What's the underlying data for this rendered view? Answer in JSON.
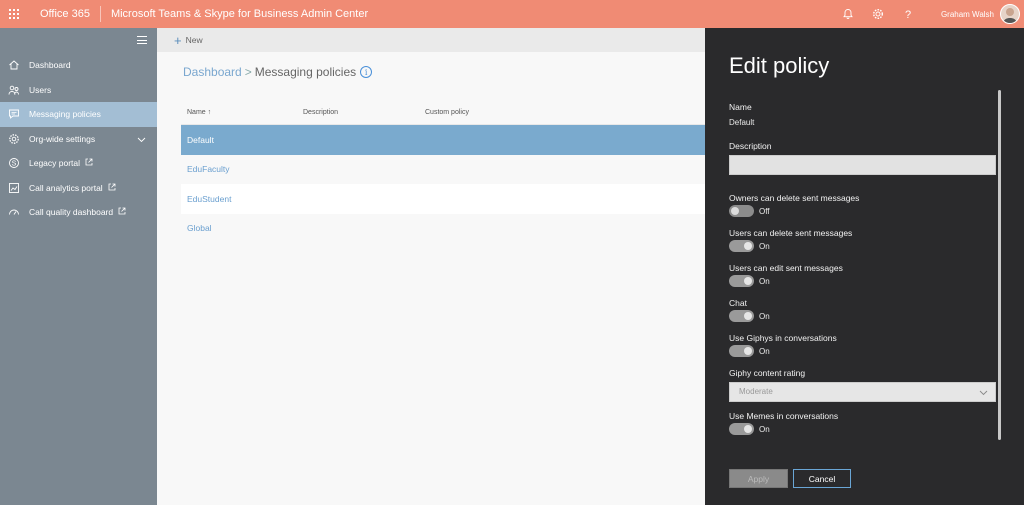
{
  "header": {
    "brand": "Office 365",
    "app_title": "Microsoft Teams & Skype for Business Admin Center",
    "user_name": "Graham Walsh",
    "icons": [
      "waffle-icon",
      "bell-icon",
      "gear-icon",
      "help-icon"
    ]
  },
  "sidebar": {
    "items": [
      {
        "label": "Dashboard",
        "icon": "home-icon"
      },
      {
        "label": "Users",
        "icon": "users-icon"
      },
      {
        "label": "Messaging policies",
        "icon": "chat-icon",
        "active": true
      },
      {
        "label": "Org-wide settings",
        "icon": "gear-icon"
      },
      {
        "label": "Legacy portal",
        "icon": "skype-icon",
        "external": true
      },
      {
        "label": "Call analytics portal",
        "icon": "chart-icon",
        "external": true
      },
      {
        "label": "Call quality dashboard",
        "icon": "dashboard-icon",
        "external": true
      }
    ]
  },
  "main": {
    "new_label": "New",
    "breadcrumb": {
      "root": "Dashboard",
      "sep": ">",
      "current": "Messaging policies",
      "info": "i"
    },
    "table": {
      "headers": {
        "name": "Name",
        "sort": "↑",
        "description": "Description",
        "custom": "Custom policy"
      },
      "rows": [
        "Default",
        "EduFaculty",
        "EduStudent",
        "Global"
      ]
    }
  },
  "panel": {
    "title": "Edit policy",
    "name_label": "Name",
    "name_value": "Default",
    "description_label": "Description",
    "description_value": "",
    "settings": [
      {
        "label": "Owners can delete sent messages",
        "state": "Off"
      },
      {
        "label": "Users can delete sent messages",
        "state": "On"
      },
      {
        "label": "Users can edit sent messages",
        "state": "On"
      },
      {
        "label": "Chat",
        "state": "On"
      },
      {
        "label": "Use Giphys in conversations",
        "state": "On"
      }
    ],
    "giphy_rating_label": "Giphy content rating",
    "giphy_rating_value": "Moderate",
    "memes_label": "Use Memes in conversations",
    "memes_state": "On",
    "apply_label": "Apply",
    "cancel_label": "Cancel"
  }
}
